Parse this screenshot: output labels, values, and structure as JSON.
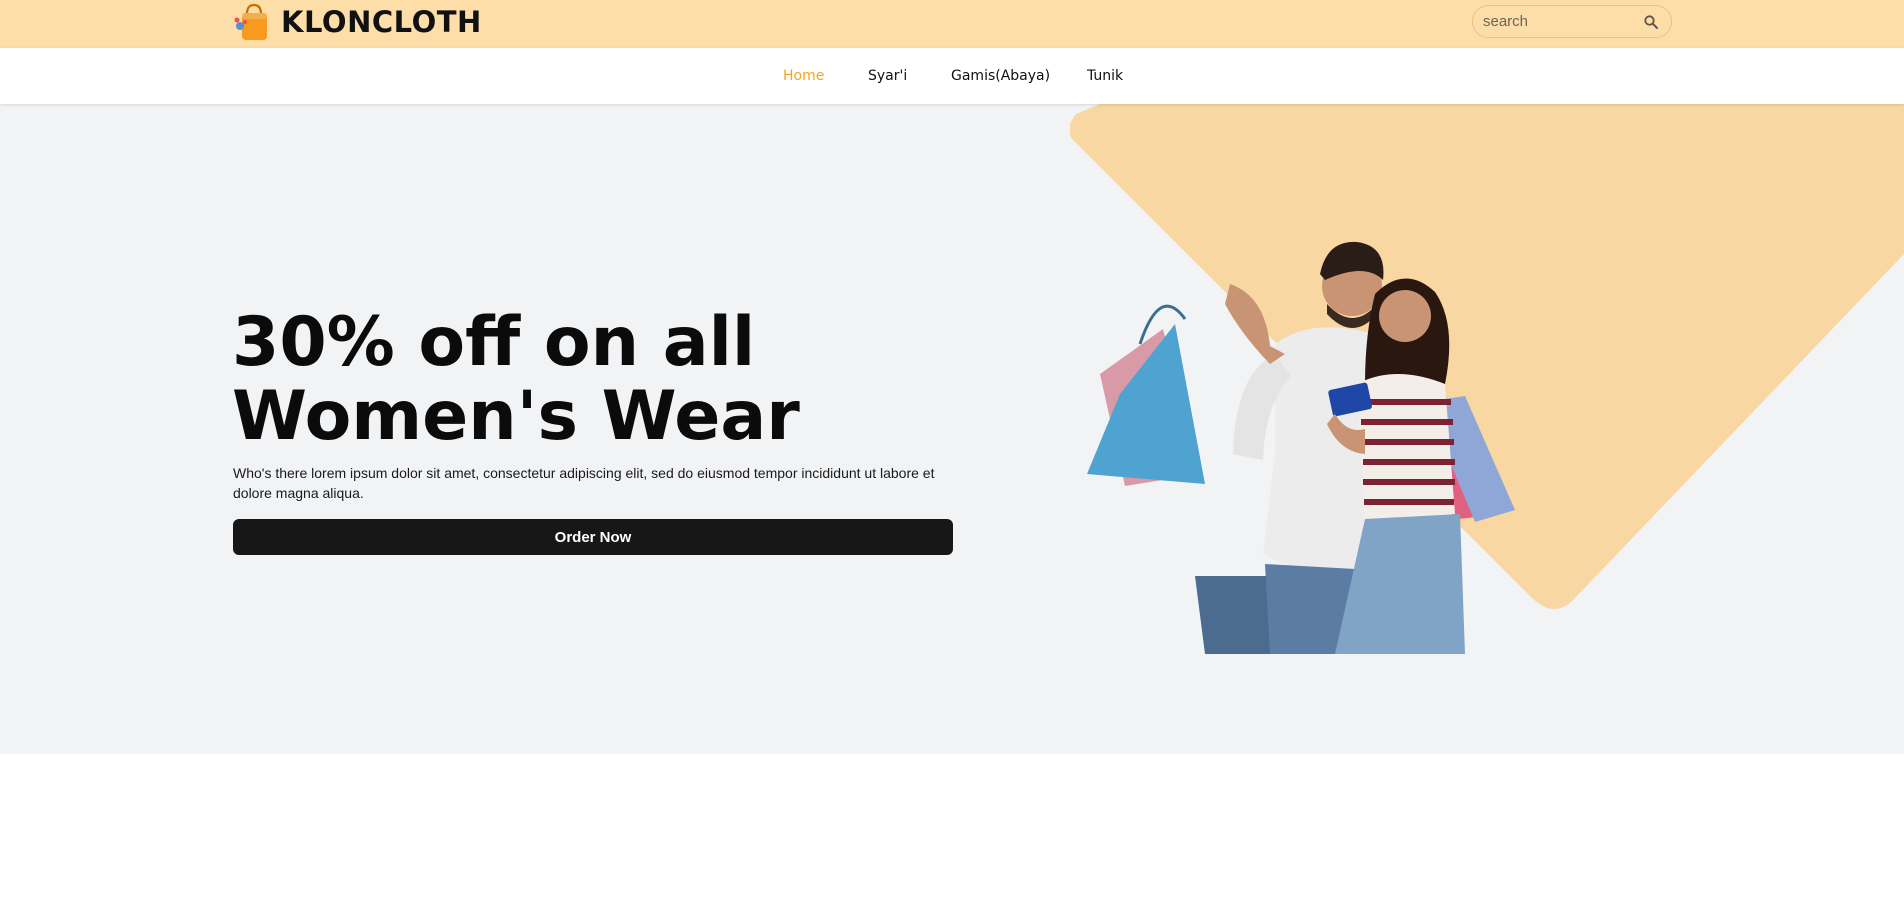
{
  "brand": {
    "name": "KLONCLOTH",
    "accent_color": "#f7a21b",
    "topbar_color": "#fedea8"
  },
  "search": {
    "placeholder": "search",
    "value": "",
    "icon": "search-icon"
  },
  "nav": {
    "items": [
      {
        "label": "Home",
        "active": true
      },
      {
        "label": "Syar'i",
        "active": false
      },
      {
        "label": "Gamis(Abaya)",
        "active": false
      },
      {
        "label": "Tunik",
        "active": false
      }
    ]
  },
  "hero": {
    "title_line1": "30% off on all",
    "title_line2": "Women's Wear",
    "description": "Who's there lorem ipsum dolor sit amet, consectetur adipiscing elit, sed do eiusmod tempor incididunt ut labore et dolore magna aliqua.",
    "cta_label": "Order Now",
    "background_color": "#f2f3f5",
    "shape_color": "#f8d7a2"
  }
}
